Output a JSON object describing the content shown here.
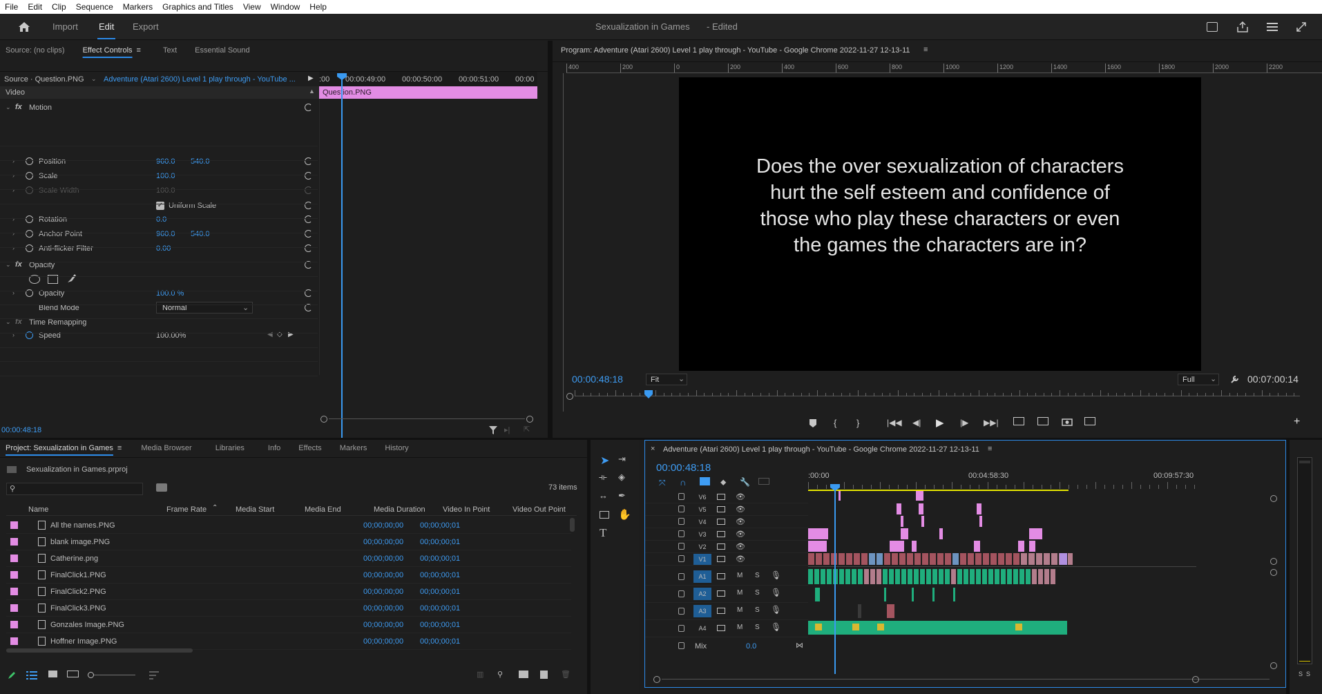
{
  "menu": [
    "File",
    "Edit",
    "Clip",
    "Sequence",
    "Markers",
    "Graphics and Titles",
    "View",
    "Window",
    "Help"
  ],
  "workspace": {
    "tabs": [
      "Import",
      "Edit",
      "Export"
    ],
    "active": "Edit",
    "title": "Sexualization in Games",
    "edited": "- Edited"
  },
  "source_panel": {
    "tabs": [
      "Source: (no clips)",
      "Effect Controls",
      "Text",
      "Essential Sound"
    ],
    "active": "Effect Controls",
    "source_label": "Source · Question.PNG",
    "sequence_label": "Adventure (Atari 2600) Level 1 play through - YouTube ...",
    "ruler": [
      ":00",
      "00:00:49:00",
      "00:00:50:00",
      "00:00:51:00",
      "00:00"
    ],
    "clip_name": "Question.PNG",
    "section_video": "Video",
    "motion": "Motion",
    "props": [
      {
        "name": "Position",
        "v1": "960.0",
        "v2": "540.0"
      },
      {
        "name": "Scale",
        "v1": "100.0",
        "v2": ""
      },
      {
        "name": "Scale Width",
        "v1": "100.0",
        "v2": ""
      },
      {
        "name": "Rotation",
        "v1": "0.0",
        "v2": ""
      },
      {
        "name": "Anchor Point",
        "v1": "960.0",
        "v2": "540.0"
      },
      {
        "name": "Anti-flicker Filter",
        "v1": "0.00",
        "v2": ""
      }
    ],
    "uniform_scale": "Uniform Scale",
    "opacity_header": "Opacity",
    "opacity_label": "Opacity",
    "opacity_value": "100.0 %",
    "blend_label": "Blend Mode",
    "blend_value": "Normal",
    "time_remap": "Time Remapping",
    "speed_label": "Speed",
    "speed_value": "100.00%",
    "timecode": "00:00:48:18"
  },
  "program": {
    "title": "Program: Adventure (Atari 2600) Level 1 play through - YouTube - Google Chrome 2022-11-27 12-13-11",
    "ruler": [
      "400",
      "200",
      "0",
      "200",
      "400",
      "600",
      "800",
      "1000",
      "1200",
      "1400",
      "1600",
      "1800",
      "2000",
      "2200"
    ],
    "frame_text": [
      "Does the over sexualization of characters",
      "hurt the self esteem and confidence of",
      "those who play these characters or even",
      "the games the characters are in?"
    ],
    "timecode": "00:00:48:18",
    "fit": "Fit",
    "quality": "Full",
    "duration": "00:07:00:14"
  },
  "project": {
    "tabs": [
      "Project: Sexualization in Games",
      "Media Browser",
      "Libraries",
      "Info",
      "Effects",
      "Markers",
      "History"
    ],
    "file": "Sexualization in Games.prproj",
    "items_count": "73 items",
    "columns": [
      "Name",
      "Frame Rate",
      "Media Start",
      "Media End",
      "Media Duration",
      "Video In Point",
      "Video Out Point"
    ],
    "rows": [
      {
        "name": "All the names.PNG",
        "in": "00;00;00;00",
        "out": "00;00;00;01"
      },
      {
        "name": "blank image.PNG",
        "in": "00;00;00;00",
        "out": "00;00;00;01"
      },
      {
        "name": "Catherine.png",
        "in": "00;00;00;00",
        "out": "00;00;00;01"
      },
      {
        "name": "FinalClick1.PNG",
        "in": "00;00;00;00",
        "out": "00;00;00;01"
      },
      {
        "name": "FinalClick2.PNG",
        "in": "00;00;00;00",
        "out": "00;00;00;01"
      },
      {
        "name": "FinalClick3.PNG",
        "in": "00;00;00;00",
        "out": "00;00;00;01"
      },
      {
        "name": "Gonzales Image.PNG",
        "in": "00;00;00;00",
        "out": "00;00;00;01"
      },
      {
        "name": "Hoffner Image.PNG",
        "in": "00;00;00;00",
        "out": "00;00;00;01"
      }
    ]
  },
  "timeline": {
    "title": "Adventure (Atari 2600) Level 1 play through - YouTube - Google Chrome 2022-11-27 12-13-11",
    "timecode": "00:00:48:18",
    "ruler": [
      ":00:00",
      "00:04:58:30",
      "00:09:57:30"
    ],
    "video_tracks": [
      "V6",
      "V5",
      "V4",
      "V3",
      "V2",
      "V1"
    ],
    "audio_tracks": [
      "A1",
      "A2",
      "A3",
      "A4"
    ],
    "mix_label": "Mix",
    "mix_value": "0.0",
    "mute": "M",
    "solo": "S"
  },
  "meter": {
    "labels": [
      "S",
      "S"
    ]
  },
  "colors": {
    "accent": "#2d8ceb",
    "clip_pink": "#e08be0",
    "clip_red": "#a4545f",
    "audio_green": "#1fae7d",
    "playhead": "#3a9af1"
  }
}
